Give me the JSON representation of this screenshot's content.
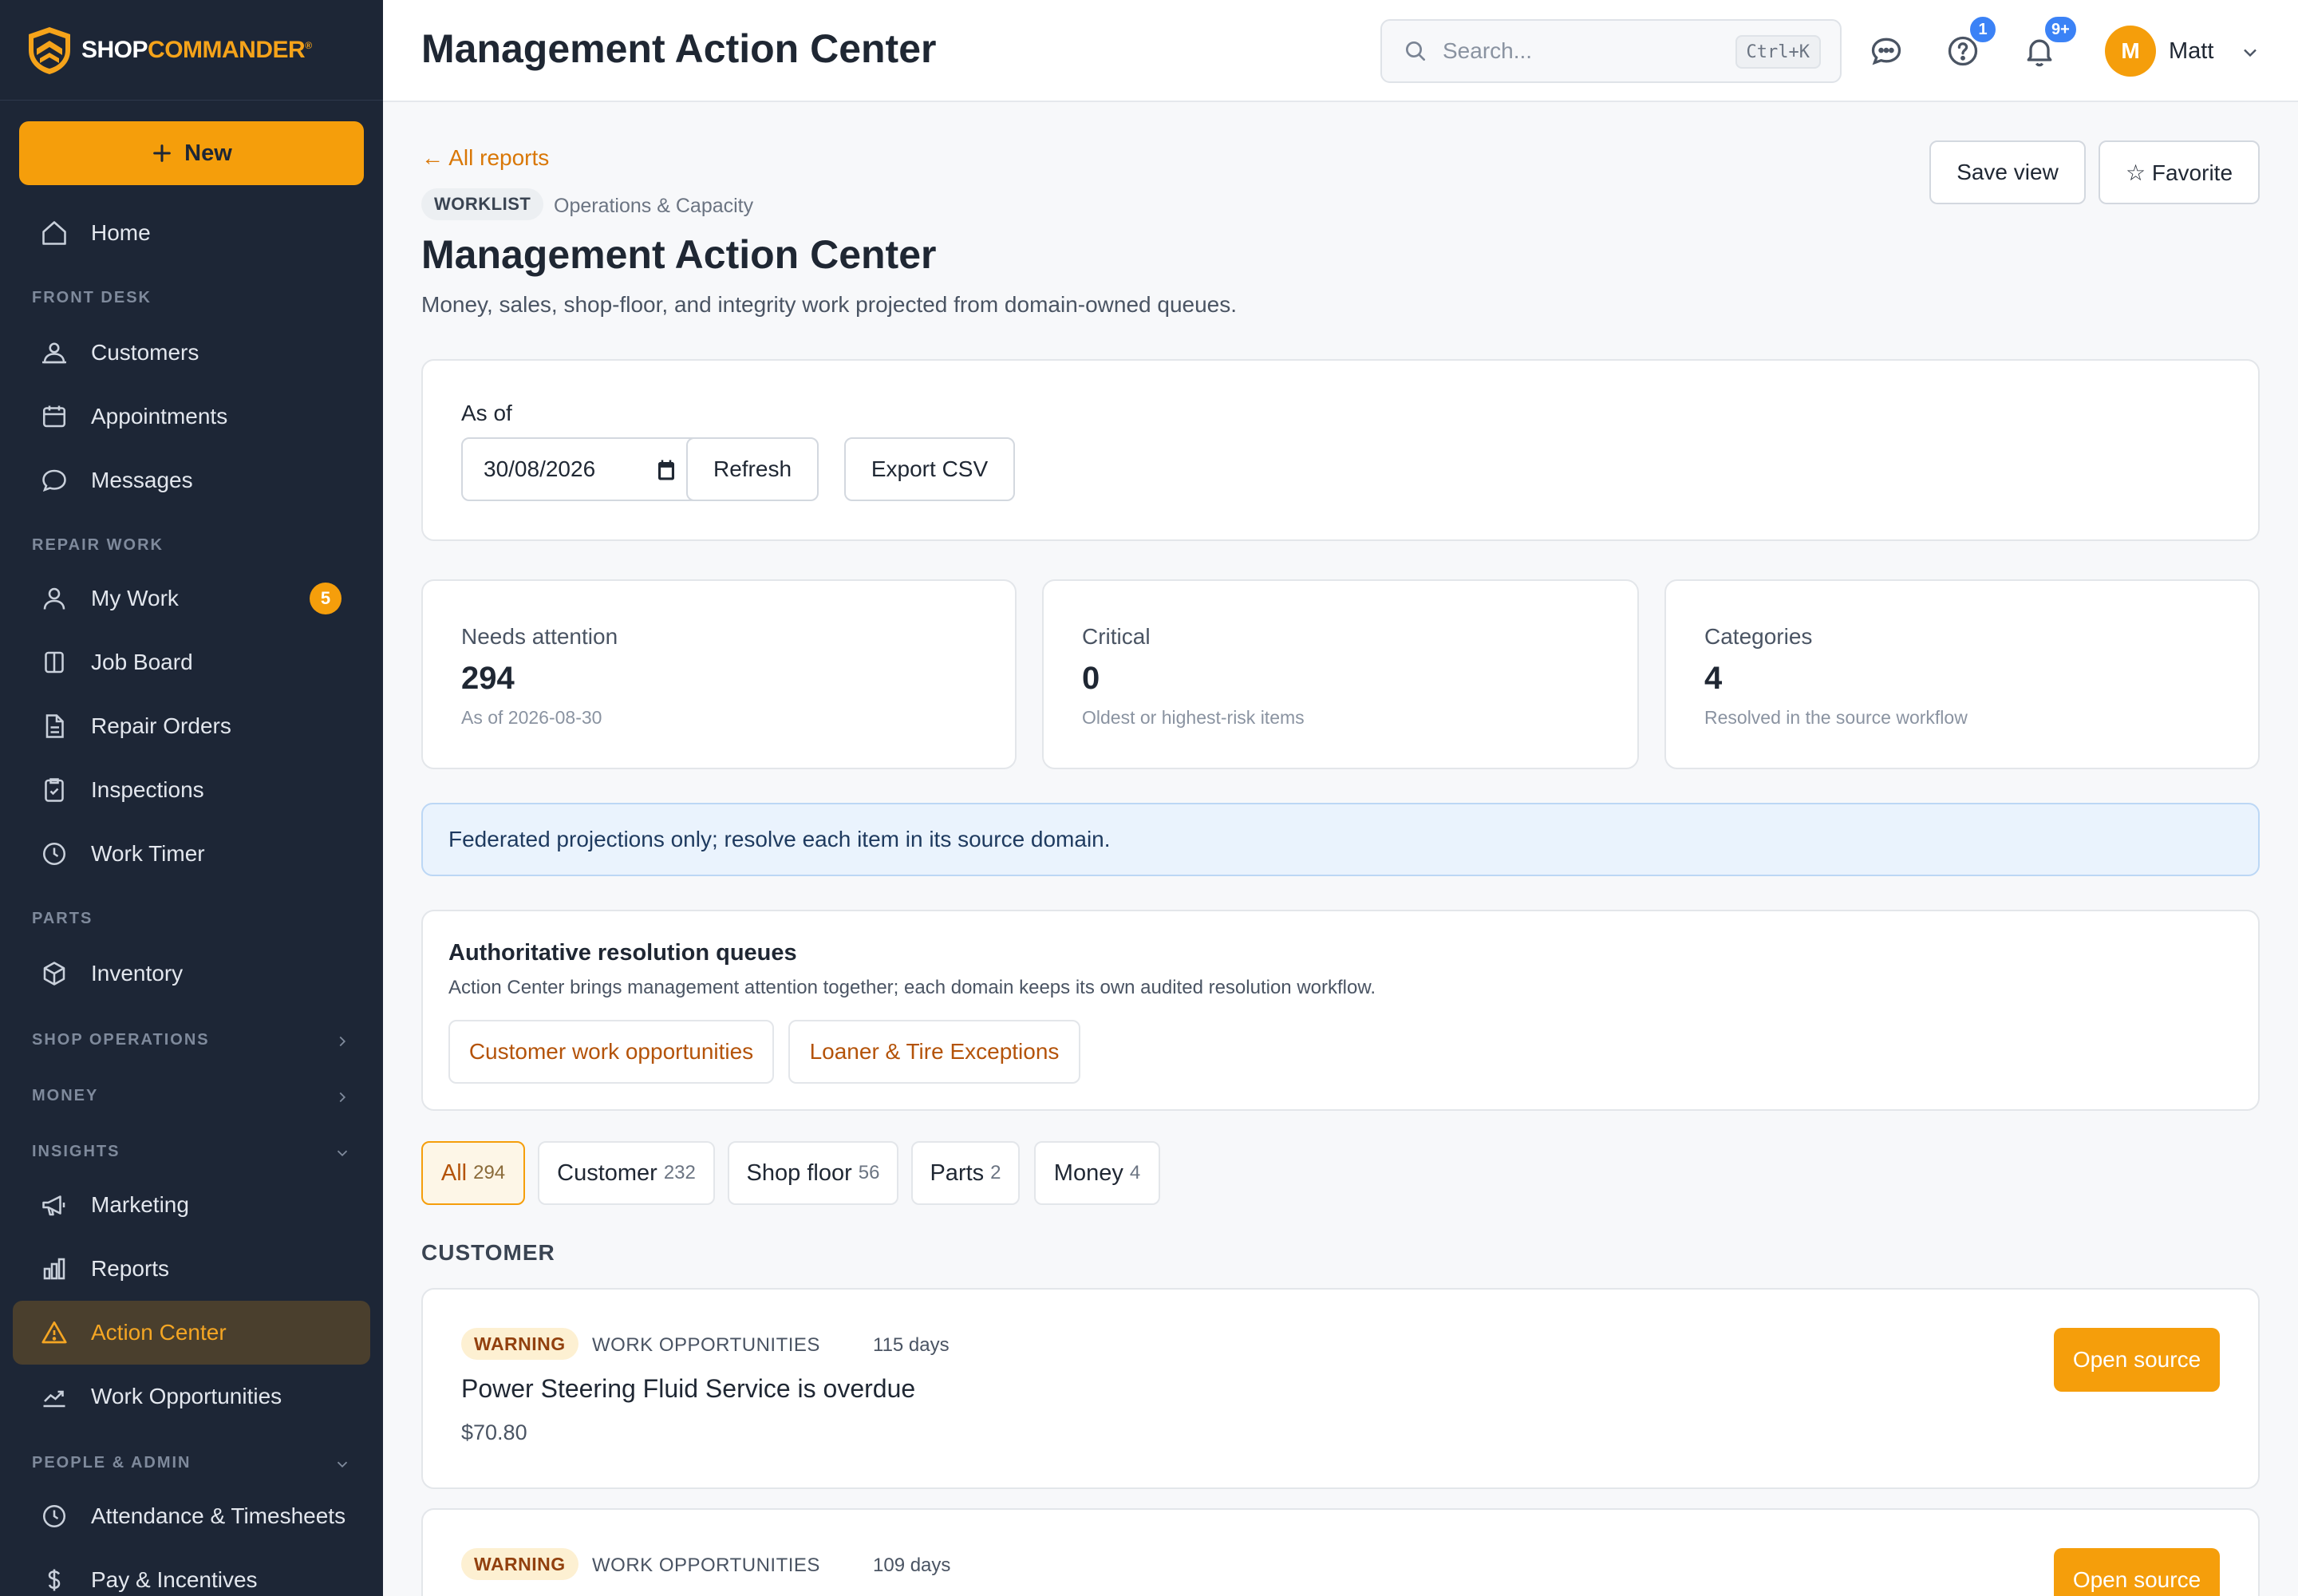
{
  "brand": {
    "name_part1": "SHOP",
    "name_part2": "COMMANDER",
    "reg": "®",
    "accent": "#f59e0b"
  },
  "sidebar": {
    "new_label": "New",
    "home": "Home",
    "sections": {
      "front_desk": "FRONT DESK",
      "repair_work": "REPAIR WORK",
      "parts": "PARTS",
      "shop_operations": "SHOP OPERATIONS",
      "money": "MONEY",
      "insights": "INSIGHTS",
      "people_admin": "PEOPLE & ADMIN"
    },
    "items": {
      "customers": "Customers",
      "appointments": "Appointments",
      "messages": "Messages",
      "my_work": "My Work",
      "my_work_badge": "5",
      "job_board": "Job Board",
      "repair_orders": "Repair Orders",
      "inspections": "Inspections",
      "work_timer": "Work Timer",
      "inventory": "Inventory",
      "marketing": "Marketing",
      "reports": "Reports",
      "action_center": "Action Center",
      "work_opportunities": "Work Opportunities",
      "attendance": "Attendance & Timesheets",
      "pay": "Pay & Incentives"
    }
  },
  "topbar": {
    "title": "Management Action Center",
    "search_placeholder": "Search...",
    "search_shortcut": "Ctrl+K",
    "help_badge": "1",
    "notif_badge": "9+",
    "avatar_initial": "M",
    "user_name": "Matt"
  },
  "page": {
    "back_link": "← All reports",
    "tag": "WORKLIST",
    "context": "Operations & Capacity",
    "title": "Management Action Center",
    "subtitle": "Money, sales, shop-floor, and integrity work projected from domain-owned queues.",
    "save_view": "Save view",
    "favorite": "☆ Favorite"
  },
  "filters_card": {
    "as_of_label": "As of",
    "date_value": "30/08/2026",
    "refresh": "Refresh",
    "export": "Export CSV"
  },
  "stats": [
    {
      "label": "Needs attention",
      "value": "294",
      "note": "As of 2026-08-30"
    },
    {
      "label": "Critical",
      "value": "0",
      "note": "Oldest or highest-risk items"
    },
    {
      "label": "Categories",
      "value": "4",
      "note": "Resolved in the source workflow"
    }
  ],
  "banner": "Federated projections only; resolve each item in its source domain.",
  "queues": {
    "title": "Authoritative resolution queues",
    "description": "Action Center brings management attention together; each domain keeps its own audited resolution workflow.",
    "links": [
      "Customer work opportunities",
      "Loaner & Tire Exceptions"
    ]
  },
  "filters": [
    {
      "label": "All",
      "count": "294",
      "active": true
    },
    {
      "label": "Customer",
      "count": "232"
    },
    {
      "label": "Shop floor",
      "count": "56"
    },
    {
      "label": "Parts",
      "count": "2"
    },
    {
      "label": "Money",
      "count": "4"
    }
  ],
  "section_heading": "CUSTOMER",
  "work_items": [
    {
      "severity": "WARNING",
      "category": "WORK OPPORTUNITIES",
      "age": "115 days",
      "title": "Power Steering Fluid Service is overdue",
      "amount": "$70.80",
      "action": "Open source"
    },
    {
      "severity": "WARNING",
      "category": "WORK OPPORTUNITIES",
      "age": "109 days",
      "action": "Open source"
    }
  ]
}
